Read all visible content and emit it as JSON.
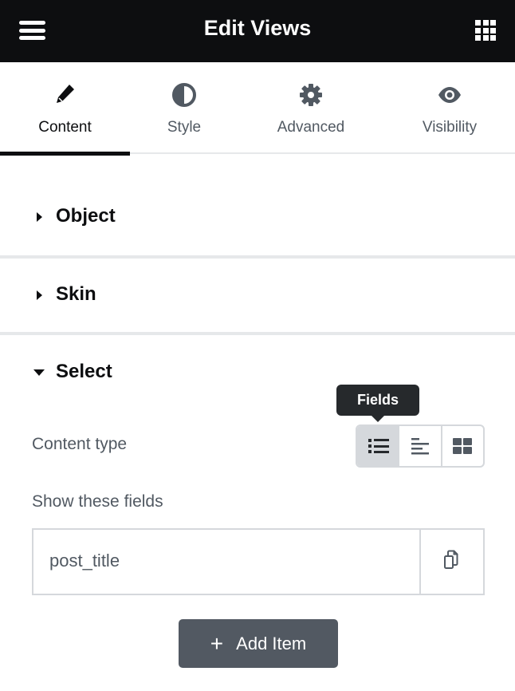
{
  "header": {
    "title": "Edit Views",
    "menu_icon": "hamburger-icon",
    "apps_icon": "grid-icon"
  },
  "tabs": [
    {
      "label": "Content",
      "icon": "pencil-icon",
      "active": true
    },
    {
      "label": "Style",
      "icon": "half-circle-icon",
      "active": false
    },
    {
      "label": "Advanced",
      "icon": "gear-icon",
      "active": false
    },
    {
      "label": "Visibility",
      "icon": "eye-icon",
      "active": false
    }
  ],
  "sections": [
    {
      "title": "Object",
      "expanded": false
    },
    {
      "title": "Skin",
      "expanded": false
    },
    {
      "title": "Select",
      "expanded": true
    }
  ],
  "select": {
    "content_type_label": "Content type",
    "tooltip": "Fields",
    "content_type_options": [
      {
        "name": "fields",
        "icon": "list-icon",
        "selected": true
      },
      {
        "name": "text",
        "icon": "align-left-icon",
        "selected": false
      },
      {
        "name": "grid",
        "icon": "grid-blocks-icon",
        "selected": false
      }
    ],
    "show_fields_label": "Show these fields",
    "fields": [
      {
        "value": "post_title"
      }
    ],
    "add_item_label": "Add Item"
  },
  "colors": {
    "header_bg": "#0d0e10",
    "text_muted": "#515962",
    "border": "#d5d8dc",
    "button_bg": "#525962",
    "tooltip_bg": "#26292c"
  }
}
